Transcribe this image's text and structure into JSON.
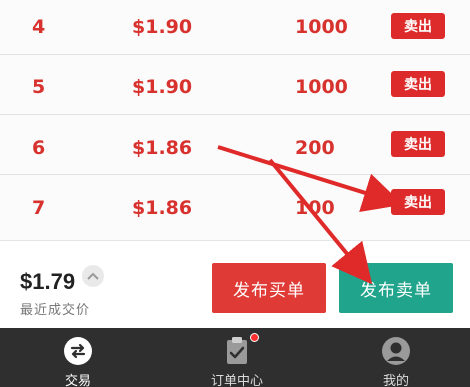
{
  "orders": [
    {
      "index": "4",
      "price": "$1.90",
      "quantity": "1000",
      "action_label": "卖出"
    },
    {
      "index": "5",
      "price": "$1.90",
      "quantity": "1000",
      "action_label": "卖出"
    },
    {
      "index": "6",
      "price": "$1.86",
      "quantity": "200",
      "action_label": "卖出"
    },
    {
      "index": "7",
      "price": "$1.86",
      "quantity": "100",
      "action_label": "卖出"
    }
  ],
  "market": {
    "last_price": "$1.79",
    "last_price_label": "最近成交价",
    "toggle_icon": "chevron-up-icon"
  },
  "actions": {
    "buy_order_label": "发布买单",
    "sell_order_label": "发布卖单"
  },
  "nav": {
    "items": [
      {
        "label": "交易",
        "icon": "swap-icon",
        "active": true
      },
      {
        "label": "订单中心",
        "icon": "clipboard-check-icon",
        "badge": true
      },
      {
        "label": "我的",
        "icon": "profile-icon",
        "active": false
      }
    ]
  },
  "colors": {
    "accent_red": "#dc2b2a",
    "accent_green": "#20a48c",
    "nav_bg": "#2f2f2f",
    "annotation_arrow": "#e02a2a"
  }
}
